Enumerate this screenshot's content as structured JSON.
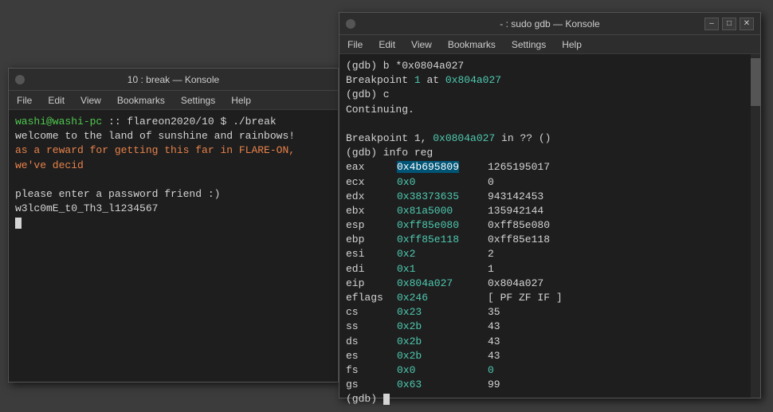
{
  "left_window": {
    "title": "10 : break — Konsole",
    "menu_items": [
      "File",
      "Edit",
      "View",
      "Bookmarks",
      "Settings",
      "Help"
    ],
    "terminal_lines": [
      {
        "type": "prompt",
        "user": "washi@washi-pc",
        "path": ":: flareon2020/10",
        "symbol": "$",
        "cmd": " ./break"
      },
      {
        "type": "normal",
        "text": "welcome to the land of sunshine and rainbows!"
      },
      {
        "type": "orange",
        "text": "as a reward for getting this far in FLARE-ON, we've decid"
      },
      {
        "type": "normal",
        "text": ""
      },
      {
        "type": "normal",
        "text": "please enter a password friend :) w3lc0mE_t0_Th3_l1234567"
      },
      {
        "type": "cursor",
        "text": ""
      }
    ],
    "dot_color": "#555"
  },
  "right_window": {
    "title": "- : sudo gdb — Konsole",
    "menu_items": [
      "File",
      "Edit",
      "View",
      "Bookmarks",
      "Settings",
      "Help"
    ],
    "terminal_lines": [
      {
        "type": "normal",
        "text": "(gdb) b *0x0804a027"
      },
      {
        "type": "normal",
        "text": "Breakpoint ",
        "span1": "1",
        "span1_color": "cyan",
        "span2": " at ",
        "span3": "0x804a027",
        "span3_color": "cyan"
      },
      {
        "type": "normal",
        "text": "(gdb) c"
      },
      {
        "type": "normal",
        "text": "Continuing."
      },
      {
        "type": "normal",
        "text": ""
      },
      {
        "type": "normal",
        "text": "Breakpoint 1, ",
        "addr": "0x0804a027",
        "addr_color": "cyan",
        "rest": " in ?? ()"
      },
      {
        "type": "normal",
        "text": "(gdb) info reg"
      }
    ],
    "registers": [
      {
        "name": "eax",
        "hex": "0x4b695809",
        "dec": "1265195017",
        "highlight": true
      },
      {
        "name": "ecx",
        "hex": "0x0",
        "dec": "0"
      },
      {
        "name": "edx",
        "hex": "0x38373635",
        "dec": "943142453"
      },
      {
        "name": "ebx",
        "hex": "0x81a5000",
        "dec": "135942144"
      },
      {
        "name": "esp",
        "hex": "0xff85e080",
        "dec": "0xff85e080"
      },
      {
        "name": "ebp",
        "hex": "0xff85e118",
        "dec": "0xff85e118"
      },
      {
        "name": "esi",
        "hex": "0x2",
        "dec": "2"
      },
      {
        "name": "edi",
        "hex": "0x1",
        "dec": "1"
      },
      {
        "name": "eip",
        "hex": "0x804a027",
        "dec": "0x804a027"
      },
      {
        "name": "eflags",
        "hex": "0x246",
        "dec": "[ PF ZF IF ]"
      },
      {
        "name": "cs",
        "hex": "0x23",
        "dec": "35"
      },
      {
        "name": "ss",
        "hex": "0x2b",
        "dec": "43"
      },
      {
        "name": "ds",
        "hex": "0x2b",
        "dec": "43"
      },
      {
        "name": "es",
        "hex": "0x2b",
        "dec": "43"
      },
      {
        "name": "fs",
        "hex": "0x0",
        "dec": "0",
        "dec_color": "cyan"
      },
      {
        "name": "gs",
        "hex": "0x63",
        "dec": "99"
      }
    ],
    "prompt_line": "(gdb) "
  }
}
